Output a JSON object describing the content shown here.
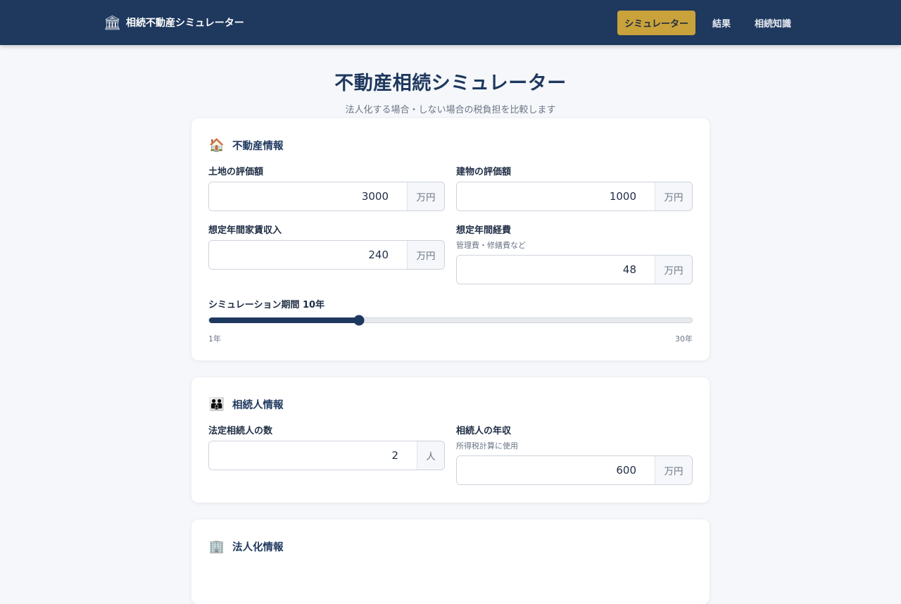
{
  "header": {
    "brand_icon": "bank-icon",
    "brand_glyph": "🏛",
    "brand_text": "相続不動産シミュレーター",
    "nav": [
      {
        "label": "シミュレーター",
        "active": true
      },
      {
        "label": "結果",
        "active": false
      },
      {
        "label": "相続知識",
        "active": false
      }
    ],
    "colors": {
      "bar": "#1e385e",
      "active": "#c9a23c"
    }
  },
  "hero": {
    "title": "不動産相続シミュレーター",
    "subtitle": "法人化する場合・しない場合の税負担を比較します"
  },
  "property": {
    "icon": "house-icon",
    "glyph": "🏠",
    "title": "不動産情報",
    "land_value": {
      "label": "土地の評価額",
      "value": "3000",
      "unit": "万円"
    },
    "building_value": {
      "label": "建物の評価額",
      "value": "1000",
      "unit": "万円"
    },
    "rent_income": {
      "label": "想定年間家賃収入",
      "value": "240",
      "unit": "万円"
    },
    "expenses": {
      "label": "想定年間経費",
      "hint": "管理費・修繕費など",
      "value": "48",
      "unit": "万円"
    },
    "period": {
      "label": "シミュレーション期間 10年",
      "value": 10,
      "min": 1,
      "max": 30,
      "min_label": "1年",
      "max_label": "30年"
    }
  },
  "heirs": {
    "icon": "family-icon",
    "glyph": "👪",
    "title": "相続人情報",
    "count": {
      "label": "法定相続人の数",
      "value": "2",
      "unit": "人"
    },
    "income": {
      "label": "相続人の年収",
      "hint": "所得税計算に使用",
      "value": "600",
      "unit": "万円"
    }
  },
  "corporate": {
    "icon": "office-building-icon",
    "glyph": "🏢",
    "title": "法人化情報"
  }
}
